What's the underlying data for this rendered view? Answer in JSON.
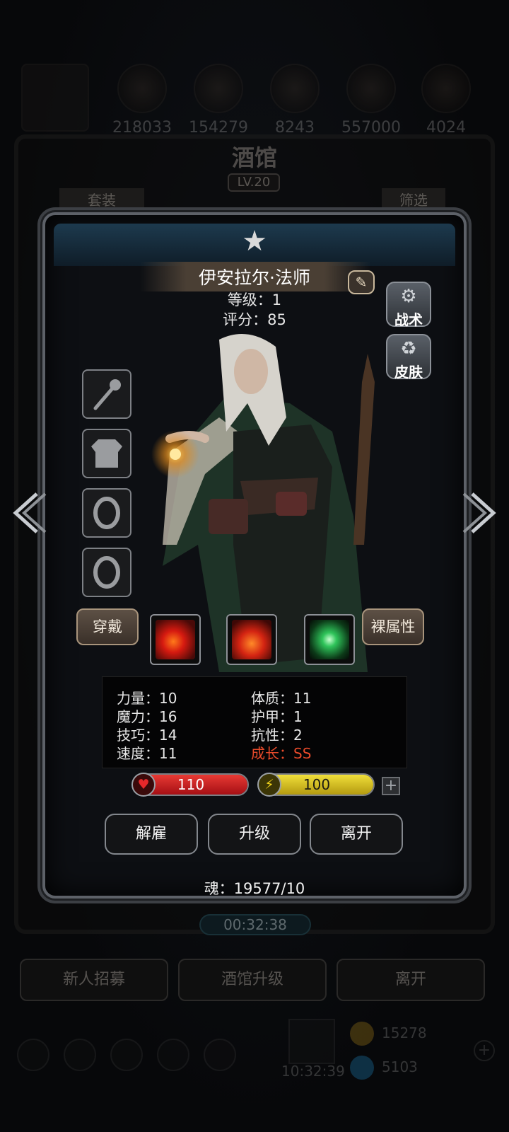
{
  "background": {
    "resources": [
      "218033",
      "154279",
      "8243",
      "557000",
      "4024"
    ],
    "tavern_title": "酒馆",
    "tavern_level": "LV.20",
    "tab_left": "套装",
    "tab_right": "筛选",
    "timer": "00:32:38",
    "buttons": [
      "新人招募",
      "酒馆升级",
      "离开"
    ],
    "bottom_time": "10:32:39",
    "gold": "15278",
    "gems": "5103"
  },
  "hero": {
    "name": "伊安拉尔·法师",
    "level_line": "等级：1",
    "score_line": "评分：85"
  },
  "side_buttons": {
    "tactics": "战术",
    "skin": "皮肤"
  },
  "actions": {
    "wear": "穿戴",
    "naked_attrs": "裸属性"
  },
  "stats": {
    "strength": "力量：10",
    "magic": "魔力：16",
    "skill": "技巧：14",
    "speed": "速度：11",
    "constitution": "体质：11",
    "armor": "护甲：1",
    "resistance": "抗性：2",
    "growth": "成长：SS"
  },
  "bars": {
    "hp": "110",
    "energy": "100",
    "plus": "+"
  },
  "buttons": {
    "dismiss": "解雇",
    "upgrade": "升级",
    "leave": "离开"
  },
  "soul": "魂：19577/10",
  "colors": {
    "growth": "#ea4b2b",
    "hp_fill": "#c0181c",
    "energy_fill": "#d9c21a",
    "name_plate": "#4a3f34"
  }
}
